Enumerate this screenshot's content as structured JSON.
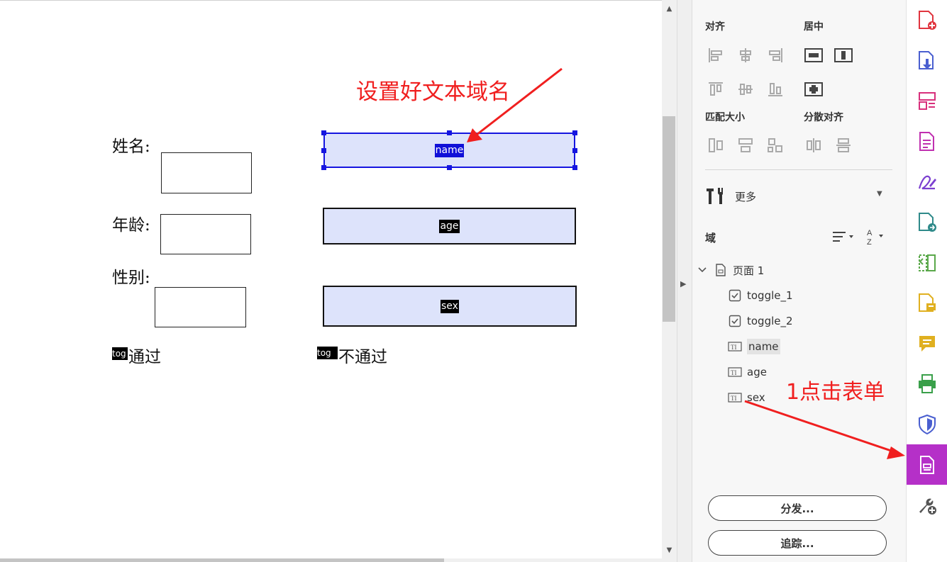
{
  "document": {
    "labels": {
      "name": "姓名:",
      "age": "年龄:",
      "sex": "性别:",
      "pass": "通过",
      "fail": "不通过"
    },
    "fields": {
      "name": "name",
      "age": "age",
      "sex": "sex"
    },
    "toggles": {
      "left": "tog",
      "right": "tog"
    }
  },
  "annotations": {
    "field_name_note": "设置好文本域名",
    "click_form_note": "1点击表单"
  },
  "panel": {
    "align_title": "对齐",
    "center_title": "居中",
    "match_size_title": "匹配大小",
    "distribute_title": "分散对齐",
    "more_label": "更多",
    "fields_title": "域",
    "tree": {
      "page_label": "页面 1",
      "items": [
        {
          "label": "toggle_1",
          "type": "checkbox"
        },
        {
          "label": "toggle_2",
          "type": "checkbox"
        },
        {
          "label": "name",
          "type": "text"
        },
        {
          "label": "age",
          "type": "text"
        },
        {
          "label": "sex",
          "type": "text"
        }
      ]
    },
    "distribute_button": "分发...",
    "track_button": "追踪..."
  },
  "rail": {
    "icons": [
      "create-pdf-icon",
      "export-pdf-icon",
      "organize-pages-icon",
      "edit-pdf-icon",
      "fill-sign-icon",
      "send-for-signature-icon",
      "compare-icon",
      "comment-icon",
      "comment-bubble-icon",
      "print-production-icon",
      "protect-icon",
      "prepare-form-icon",
      "more-tools-icon"
    ],
    "active": "prepare-form-icon"
  },
  "colors": {
    "accent": "#b530c8",
    "annotation": "#f01f1f",
    "selection": "#1515e0",
    "field_bg": "#dde3fb"
  }
}
